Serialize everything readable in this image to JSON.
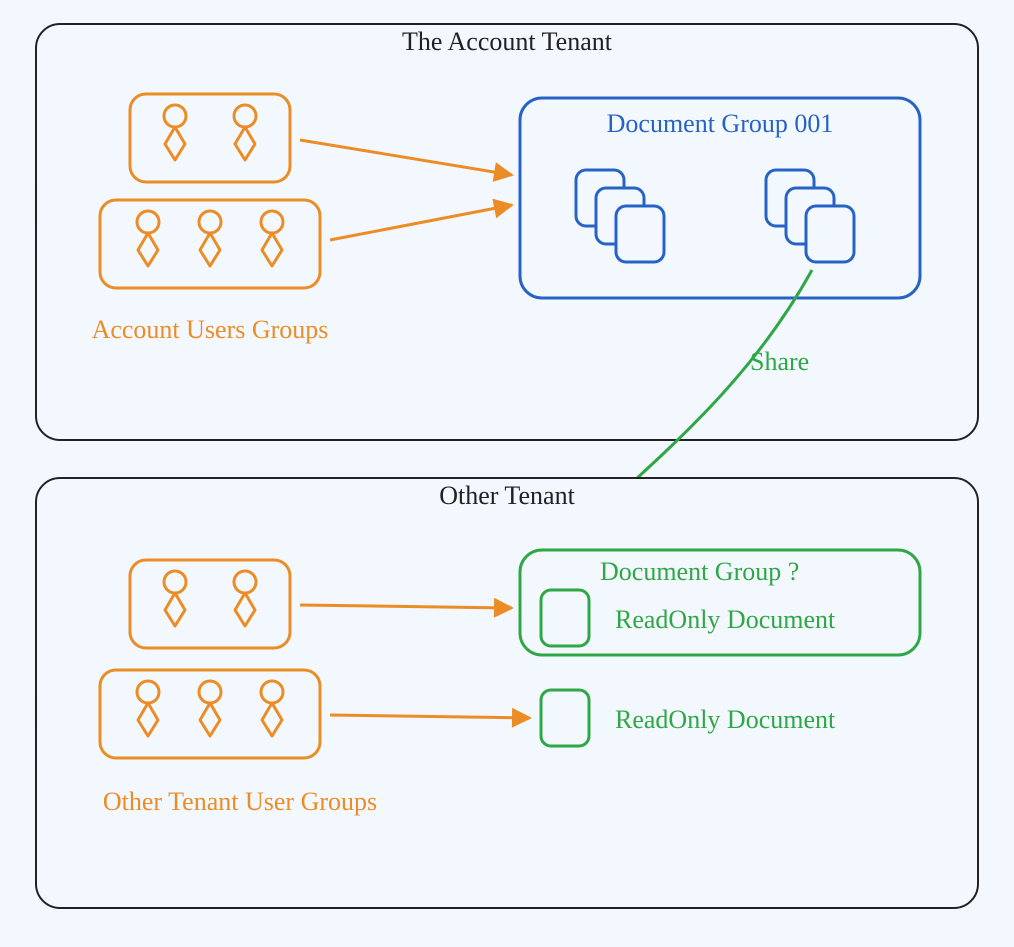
{
  "diagram": {
    "tenants": {
      "account": {
        "title": "The Account Tenant",
        "usersGroupsLabel": "Account Users Groups",
        "documentGroup": {
          "title": "Document Group 001"
        }
      },
      "other": {
        "title": "Other Tenant",
        "usersGroupsLabel": "Other Tenant User Groups",
        "documentGroup": {
          "title": "Document Group ?",
          "readOnlyLabel1": "ReadOnly Document",
          "readOnlyLabel2": "ReadOnly Document"
        }
      }
    },
    "shareLabel": "Share",
    "colors": {
      "orange": "#eb8c25",
      "blue": "#2763c4",
      "green": "#2fa746",
      "black": "#222222",
      "bg": "#f3f8ff"
    }
  }
}
